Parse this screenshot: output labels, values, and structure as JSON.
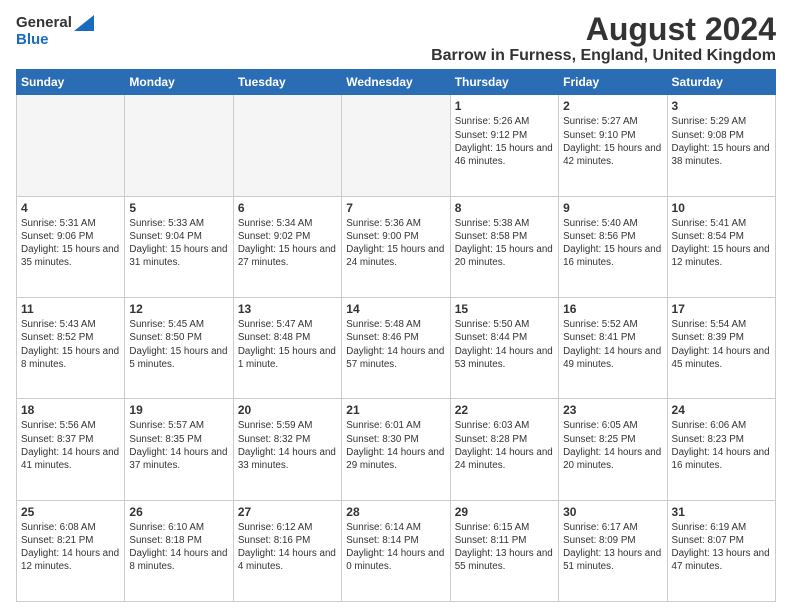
{
  "header": {
    "logo_general": "General",
    "logo_blue": "Blue",
    "title": "August 2024",
    "subtitle": "Barrow in Furness, England, United Kingdom"
  },
  "days_of_week": [
    "Sunday",
    "Monday",
    "Tuesday",
    "Wednesday",
    "Thursday",
    "Friday",
    "Saturday"
  ],
  "weeks": [
    [
      {
        "day": "",
        "info": ""
      },
      {
        "day": "",
        "info": ""
      },
      {
        "day": "",
        "info": ""
      },
      {
        "day": "",
        "info": ""
      },
      {
        "day": "1",
        "info": "Sunrise: 5:26 AM\nSunset: 9:12 PM\nDaylight: 15 hours\nand 46 minutes."
      },
      {
        "day": "2",
        "info": "Sunrise: 5:27 AM\nSunset: 9:10 PM\nDaylight: 15 hours\nand 42 minutes."
      },
      {
        "day": "3",
        "info": "Sunrise: 5:29 AM\nSunset: 9:08 PM\nDaylight: 15 hours\nand 38 minutes."
      }
    ],
    [
      {
        "day": "4",
        "info": "Sunrise: 5:31 AM\nSunset: 9:06 PM\nDaylight: 15 hours\nand 35 minutes."
      },
      {
        "day": "5",
        "info": "Sunrise: 5:33 AM\nSunset: 9:04 PM\nDaylight: 15 hours\nand 31 minutes."
      },
      {
        "day": "6",
        "info": "Sunrise: 5:34 AM\nSunset: 9:02 PM\nDaylight: 15 hours\nand 27 minutes."
      },
      {
        "day": "7",
        "info": "Sunrise: 5:36 AM\nSunset: 9:00 PM\nDaylight: 15 hours\nand 24 minutes."
      },
      {
        "day": "8",
        "info": "Sunrise: 5:38 AM\nSunset: 8:58 PM\nDaylight: 15 hours\nand 20 minutes."
      },
      {
        "day": "9",
        "info": "Sunrise: 5:40 AM\nSunset: 8:56 PM\nDaylight: 15 hours\nand 16 minutes."
      },
      {
        "day": "10",
        "info": "Sunrise: 5:41 AM\nSunset: 8:54 PM\nDaylight: 15 hours\nand 12 minutes."
      }
    ],
    [
      {
        "day": "11",
        "info": "Sunrise: 5:43 AM\nSunset: 8:52 PM\nDaylight: 15 hours\nand 8 minutes."
      },
      {
        "day": "12",
        "info": "Sunrise: 5:45 AM\nSunset: 8:50 PM\nDaylight: 15 hours\nand 5 minutes."
      },
      {
        "day": "13",
        "info": "Sunrise: 5:47 AM\nSunset: 8:48 PM\nDaylight: 15 hours\nand 1 minute."
      },
      {
        "day": "14",
        "info": "Sunrise: 5:48 AM\nSunset: 8:46 PM\nDaylight: 14 hours\nand 57 minutes."
      },
      {
        "day": "15",
        "info": "Sunrise: 5:50 AM\nSunset: 8:44 PM\nDaylight: 14 hours\nand 53 minutes."
      },
      {
        "day": "16",
        "info": "Sunrise: 5:52 AM\nSunset: 8:41 PM\nDaylight: 14 hours\nand 49 minutes."
      },
      {
        "day": "17",
        "info": "Sunrise: 5:54 AM\nSunset: 8:39 PM\nDaylight: 14 hours\nand 45 minutes."
      }
    ],
    [
      {
        "day": "18",
        "info": "Sunrise: 5:56 AM\nSunset: 8:37 PM\nDaylight: 14 hours\nand 41 minutes."
      },
      {
        "day": "19",
        "info": "Sunrise: 5:57 AM\nSunset: 8:35 PM\nDaylight: 14 hours\nand 37 minutes."
      },
      {
        "day": "20",
        "info": "Sunrise: 5:59 AM\nSunset: 8:32 PM\nDaylight: 14 hours\nand 33 minutes."
      },
      {
        "day": "21",
        "info": "Sunrise: 6:01 AM\nSunset: 8:30 PM\nDaylight: 14 hours\nand 29 minutes."
      },
      {
        "day": "22",
        "info": "Sunrise: 6:03 AM\nSunset: 8:28 PM\nDaylight: 14 hours\nand 24 minutes."
      },
      {
        "day": "23",
        "info": "Sunrise: 6:05 AM\nSunset: 8:25 PM\nDaylight: 14 hours\nand 20 minutes."
      },
      {
        "day": "24",
        "info": "Sunrise: 6:06 AM\nSunset: 8:23 PM\nDaylight: 14 hours\nand 16 minutes."
      }
    ],
    [
      {
        "day": "25",
        "info": "Sunrise: 6:08 AM\nSunset: 8:21 PM\nDaylight: 14 hours\nand 12 minutes."
      },
      {
        "day": "26",
        "info": "Sunrise: 6:10 AM\nSunset: 8:18 PM\nDaylight: 14 hours\nand 8 minutes."
      },
      {
        "day": "27",
        "info": "Sunrise: 6:12 AM\nSunset: 8:16 PM\nDaylight: 14 hours\nand 4 minutes."
      },
      {
        "day": "28",
        "info": "Sunrise: 6:14 AM\nSunset: 8:14 PM\nDaylight: 14 hours\nand 0 minutes."
      },
      {
        "day": "29",
        "info": "Sunrise: 6:15 AM\nSunset: 8:11 PM\nDaylight: 13 hours\nand 55 minutes."
      },
      {
        "day": "30",
        "info": "Sunrise: 6:17 AM\nSunset: 8:09 PM\nDaylight: 13 hours\nand 51 minutes."
      },
      {
        "day": "31",
        "info": "Sunrise: 6:19 AM\nSunset: 8:07 PM\nDaylight: 13 hours\nand 47 minutes."
      }
    ]
  ]
}
